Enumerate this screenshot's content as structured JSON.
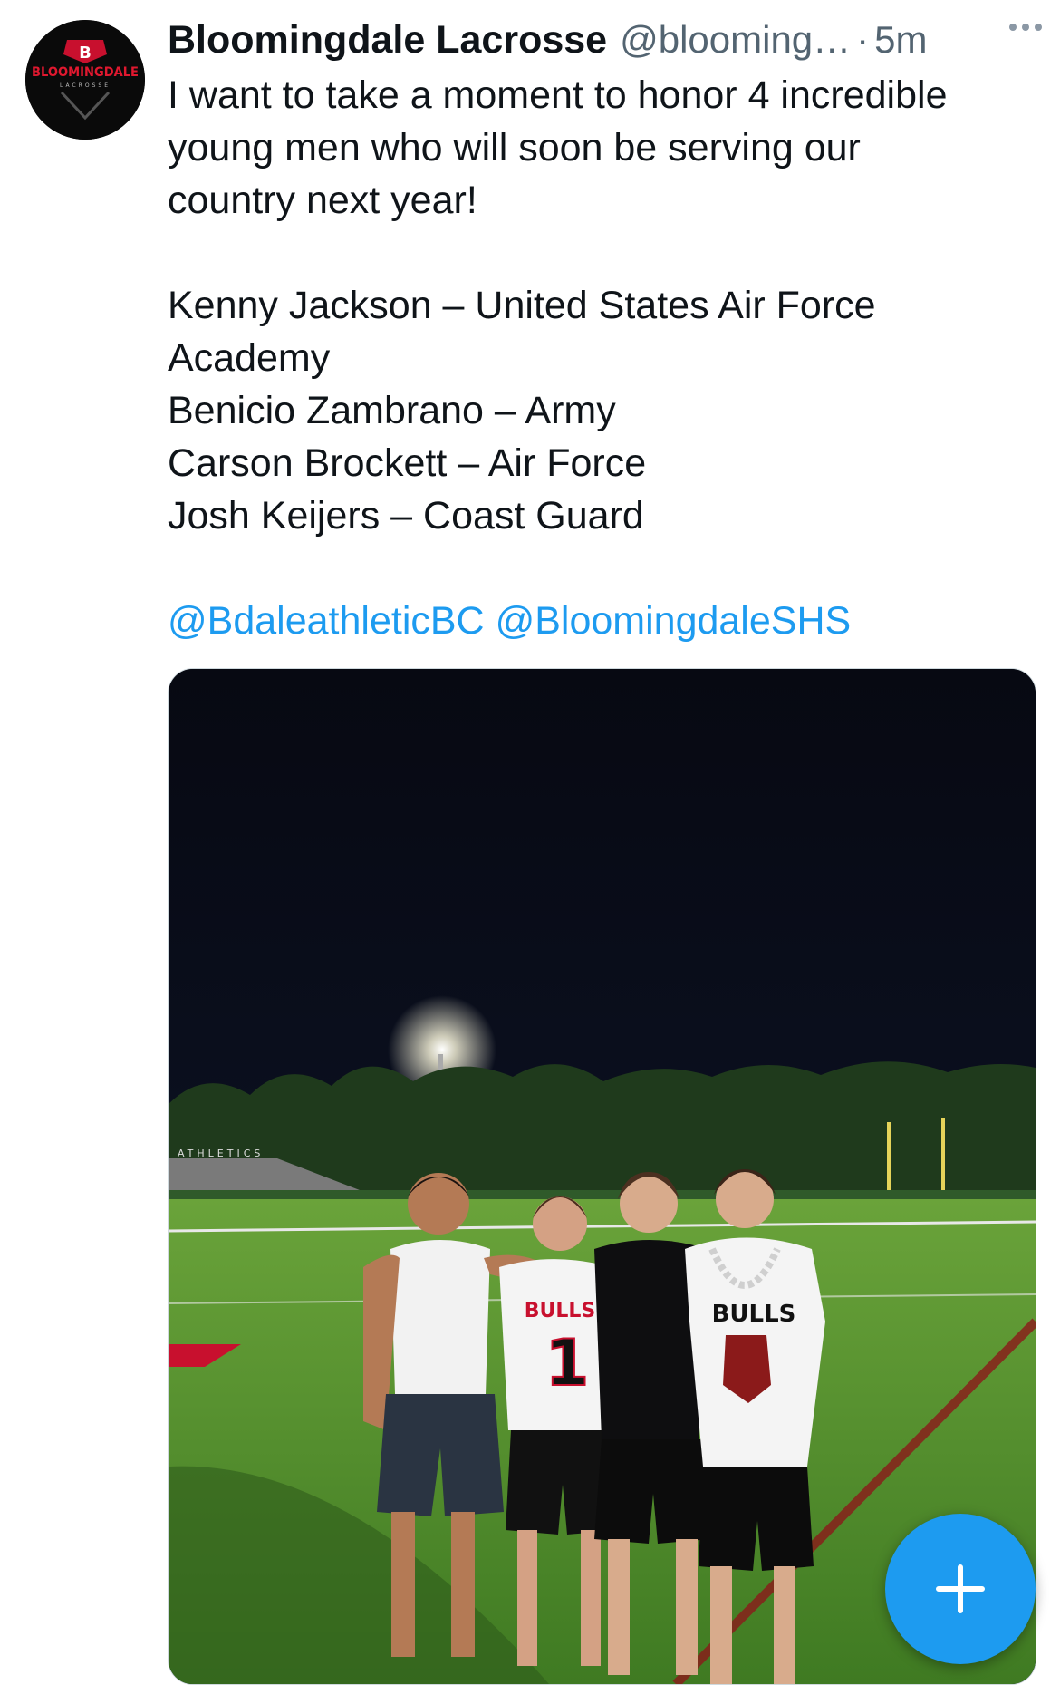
{
  "author": {
    "display_name": "Bloomingdale Lacrosse",
    "handle": "@blooming…",
    "separator": "·",
    "timestamp": "5m",
    "avatar_text": "BLOOMINGDALE",
    "avatar_subtext": "LACROSSE",
    "avatar_letter": "B"
  },
  "tweet": {
    "lines_intro": [
      "I want to take a moment to honor 4 incredible",
      "young men who will soon be serving our",
      "country next year!"
    ],
    "lines_list": [
      "Kenny Jackson – United States Air Force",
      "Academy",
      "Benicio Zambrano – Army",
      "Carson Brockett – Air Force",
      "Josh Keijers – Coast Guard"
    ],
    "mentions": [
      "@BdaleathleticBC",
      "@BloomingdaleSHS"
    ]
  },
  "media": {
    "stadium_sign": "ATHLETICS",
    "jersey_1_text": "BULLS",
    "jersey_1_number": "1",
    "jersey_2_text": "BULLS"
  },
  "icons": {
    "more": "more-horizontal-icon",
    "compose": "plus-icon"
  },
  "colors": {
    "accent": "#1d9bf0",
    "secondary_text": "#536471",
    "primary_text": "#0f1419"
  }
}
